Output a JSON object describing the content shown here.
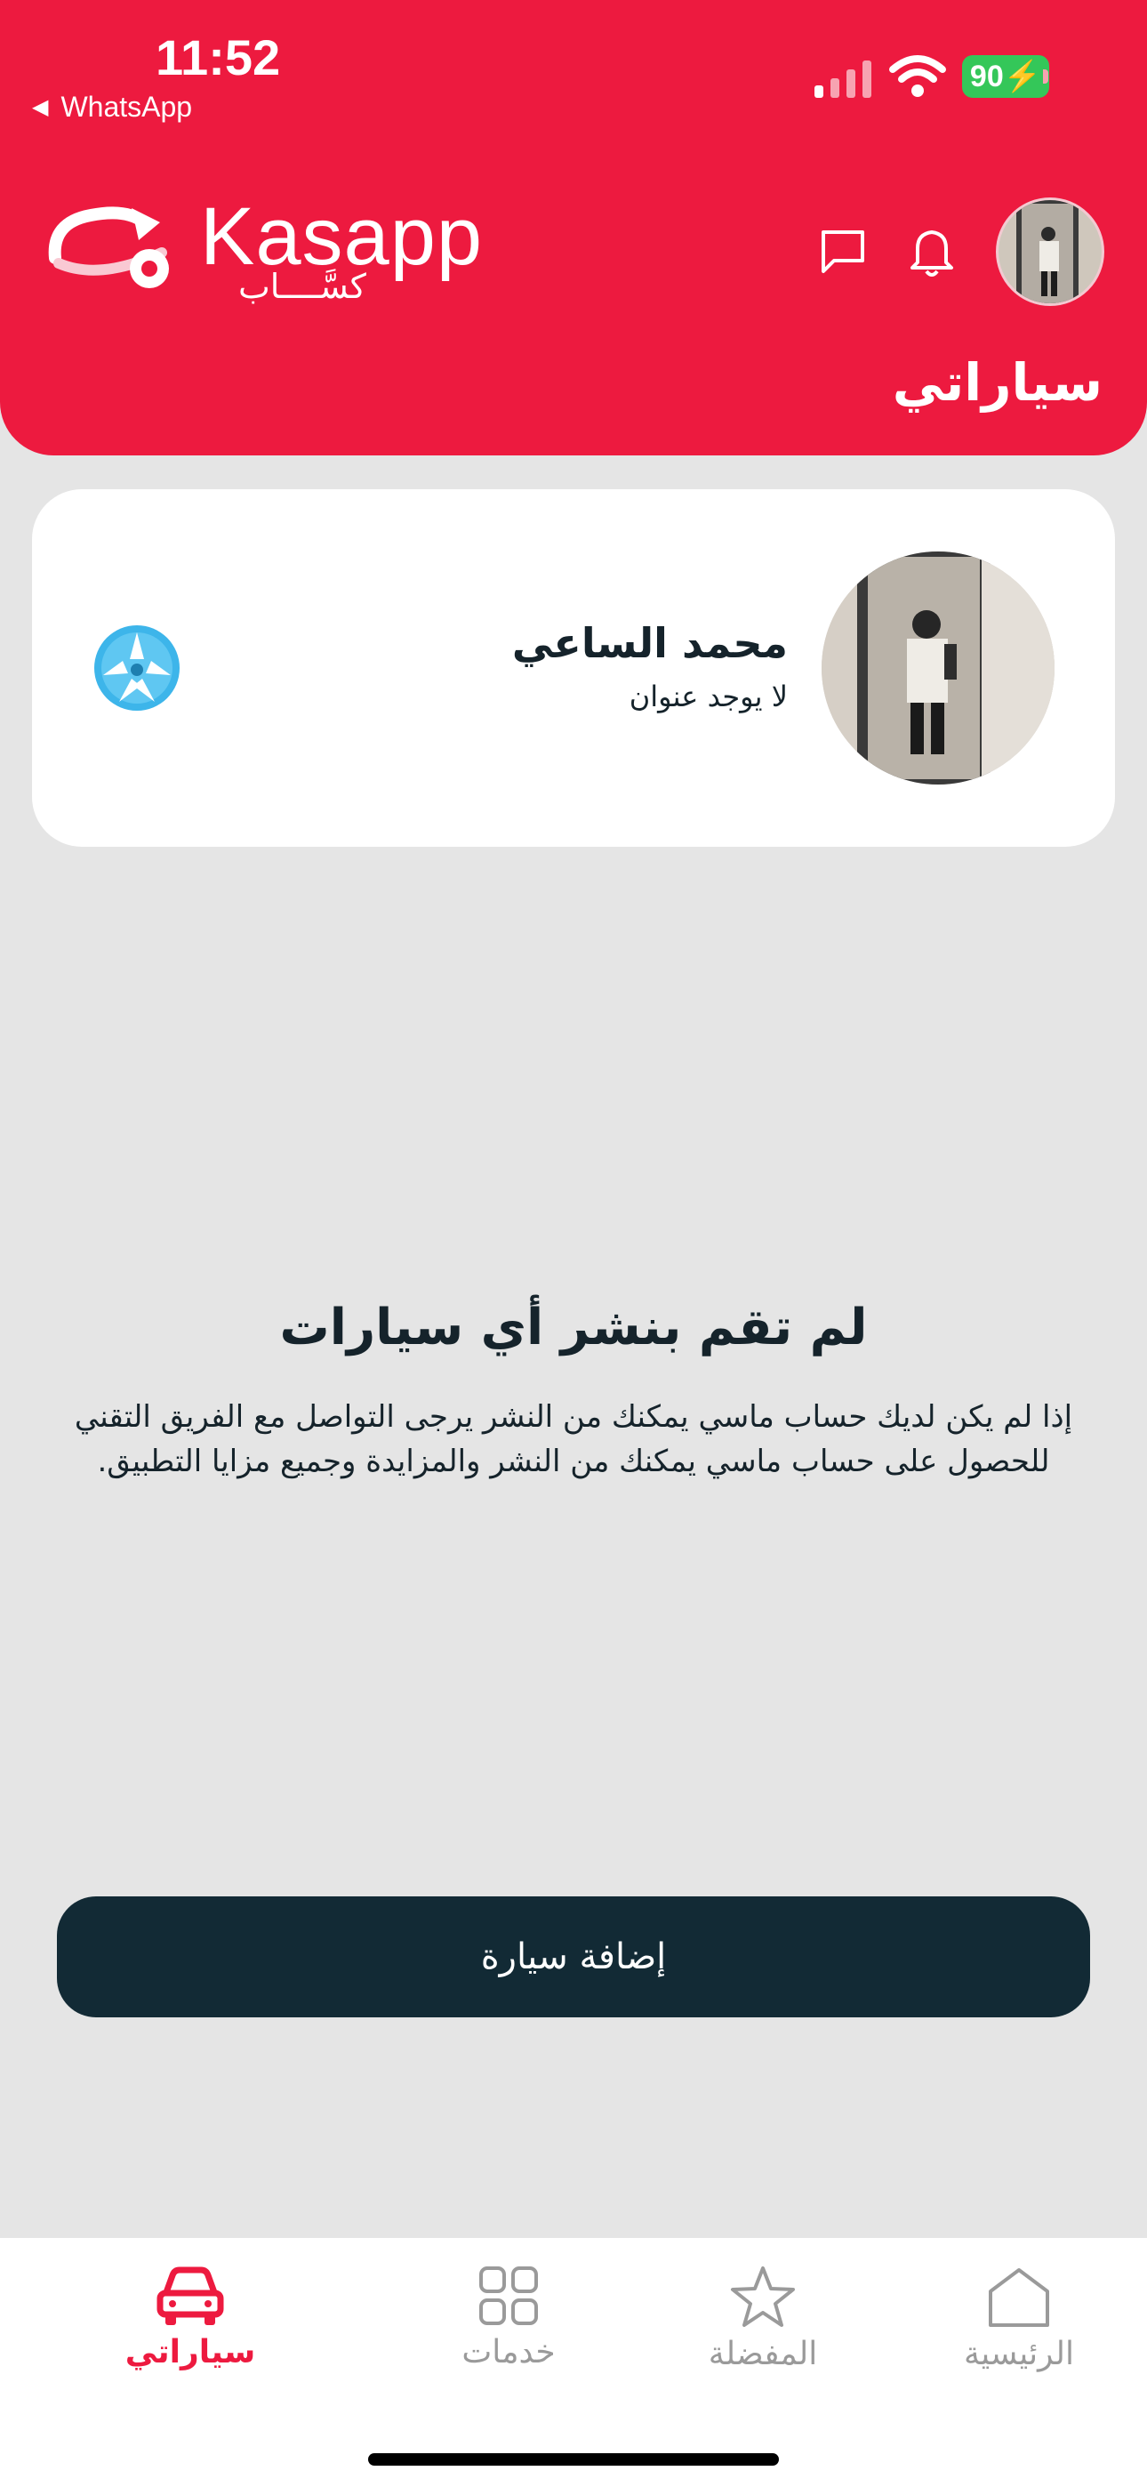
{
  "status_bar": {
    "time": "11:52",
    "back_app": "WhatsApp",
    "battery": "90"
  },
  "header": {
    "logo_text": "Kasapp",
    "logo_arabic": "كسَّــــاب",
    "page_title": "سياراتي",
    "accent_color": "#ed1a3f"
  },
  "profile": {
    "name": "محمد الساعي",
    "address": "لا يوجد عنوان"
  },
  "empty_state": {
    "title": "لم تقم بنشر أي سيارات",
    "body": "إذا لم يكن لديك حساب ماسي يمكنك من النشر يرجى التواصل مع الفريق التقني للحصول على حساب ماسي يمكنك من النشر والمزايدة وجميع مزايا التطبيق."
  },
  "actions": {
    "add_car": "إضافة سيارة"
  },
  "tabbar": {
    "tabs": [
      {
        "label": "سياراتي",
        "icon": "car-icon",
        "active": true
      },
      {
        "label": "خدمات",
        "icon": "grid-icon",
        "active": false
      },
      {
        "label": "المفضلة",
        "icon": "star-icon",
        "active": false
      },
      {
        "label": "الرئيسية",
        "icon": "home-icon",
        "active": false
      }
    ]
  }
}
